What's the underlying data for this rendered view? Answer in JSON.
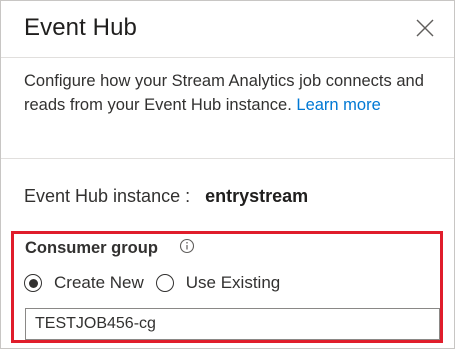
{
  "dialog": {
    "title": "Event Hub",
    "close_icon": "close-icon",
    "description": "Configure how your Stream Analytics job connects and reads from your Event Hub instance.",
    "learn_more": "Learn more"
  },
  "instance": {
    "label": "Event Hub instance :",
    "value": "entrystream"
  },
  "consumer_group": {
    "label": "Consumer group",
    "info_icon": "info-icon",
    "options": [
      {
        "label": "Create New",
        "selected": true
      },
      {
        "label": "Use Existing",
        "selected": false
      }
    ],
    "input_value": "TESTJOB456-cg"
  },
  "colors": {
    "link": "#0078d4",
    "highlight": "#e01d2b",
    "text": "#323130"
  }
}
